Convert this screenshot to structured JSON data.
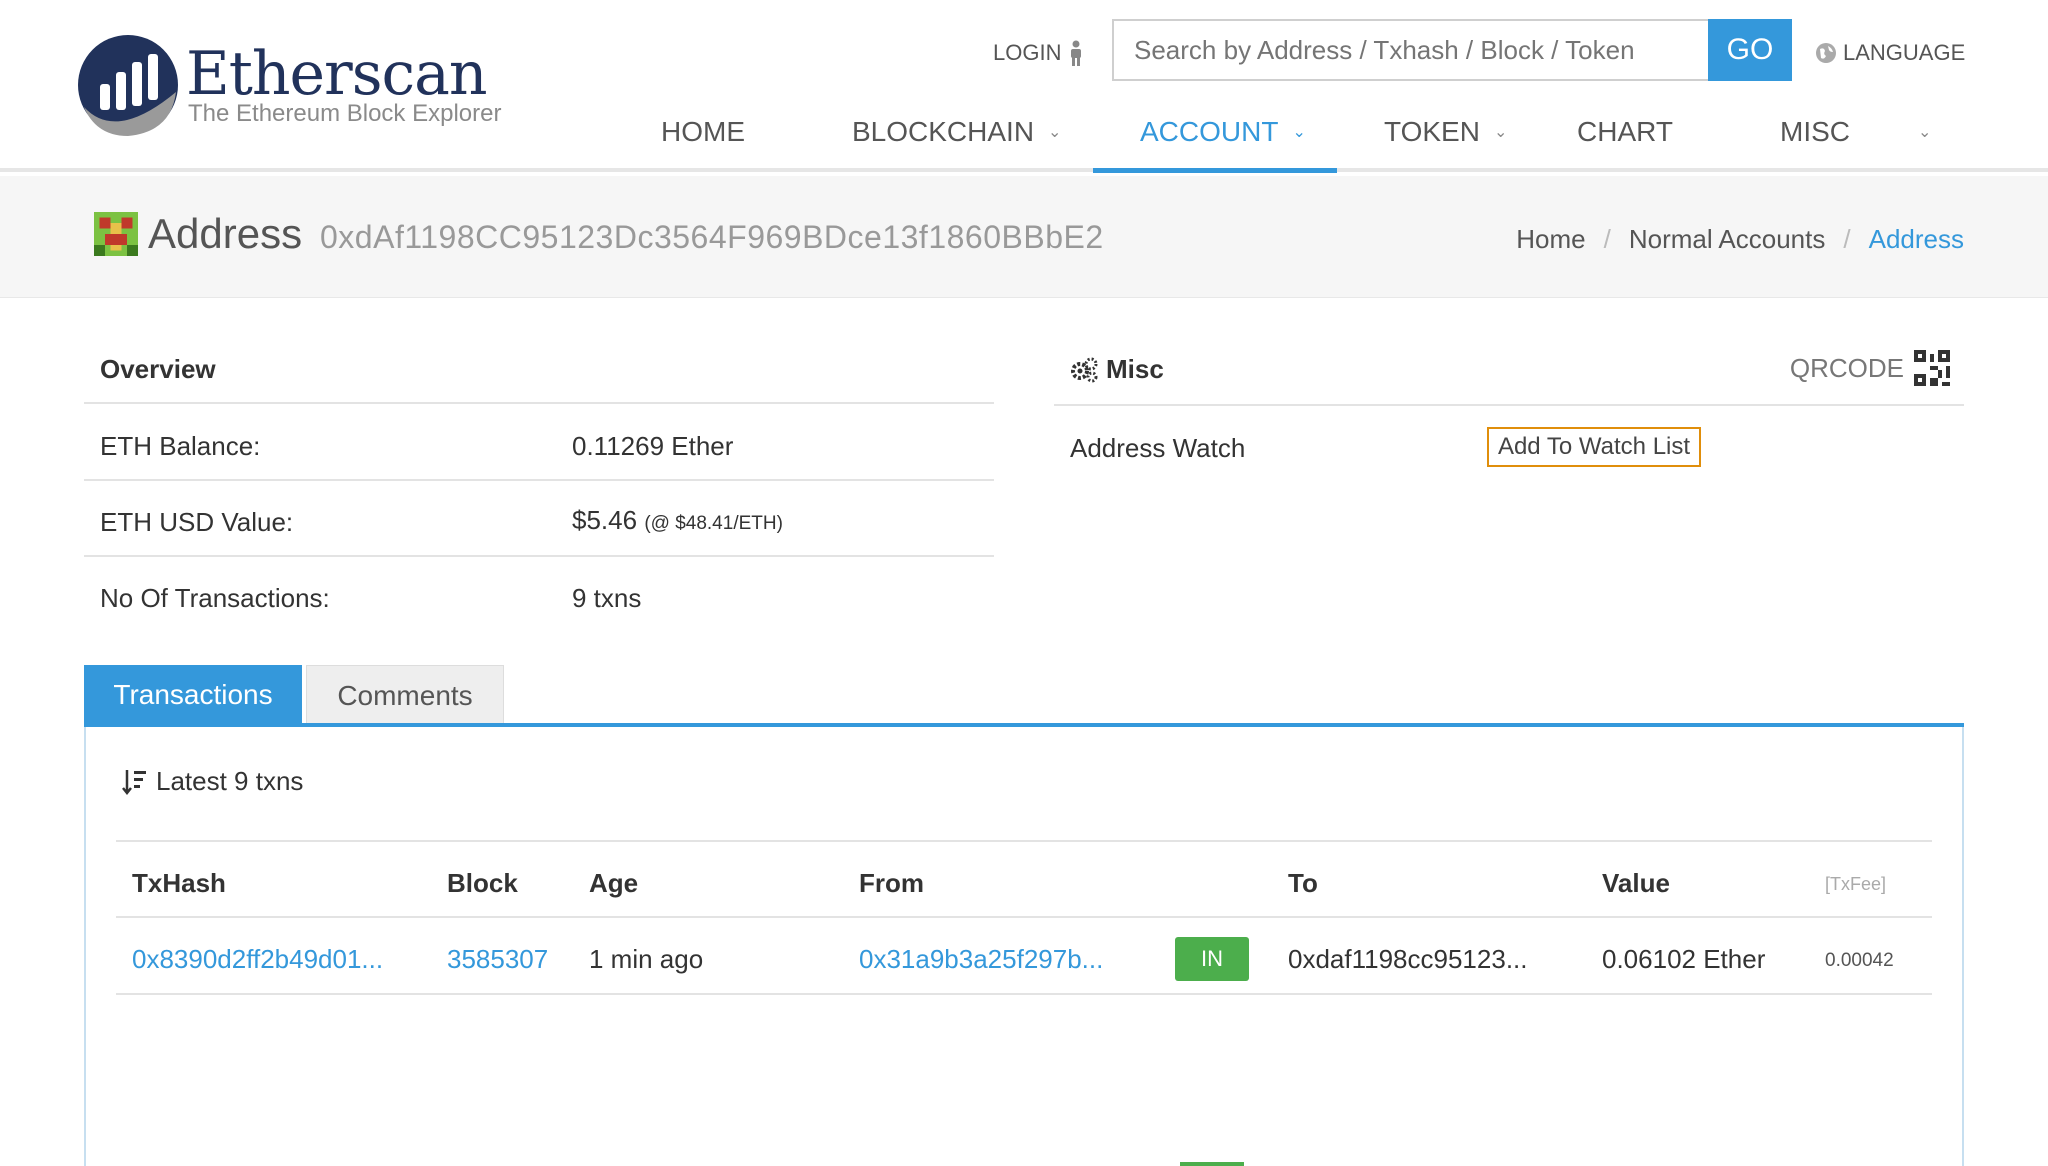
{
  "header": {
    "logo_name": "Etherscan",
    "logo_tagline": "The Ethereum Block Explorer",
    "login_label": "LOGIN",
    "search_placeholder": "Search by Address / Txhash / Block / Token",
    "go_label": "GO",
    "language_label": "LANGUAGE",
    "nav": [
      {
        "label": "HOME",
        "dropdown": false
      },
      {
        "label": "BLOCKCHAIN",
        "dropdown": true
      },
      {
        "label": "ACCOUNT",
        "dropdown": true,
        "active": true
      },
      {
        "label": "TOKEN",
        "dropdown": true
      },
      {
        "label": "CHART",
        "dropdown": false
      },
      {
        "label": "MISC",
        "dropdown": true
      }
    ],
    "accent_color": "#3498db"
  },
  "subheader": {
    "title": "Address",
    "address": "0xdAf1198CC95123Dc3564F969BDce13f1860BBbE2",
    "breadcrumb": [
      "Home",
      "Normal Accounts",
      "Address"
    ]
  },
  "overview": {
    "title": "Overview",
    "rows": [
      {
        "label": "ETH Balance:",
        "value": "0.11269 Ether"
      },
      {
        "label": "ETH USD Value:",
        "value": "$5.46",
        "note": "(@ $48.41/ETH)"
      },
      {
        "label": "No Of Transactions:",
        "value": "9 txns"
      }
    ]
  },
  "misc": {
    "title": "Misc",
    "qrcode_label": "QRCODE",
    "address_watch_label": "Address Watch",
    "watch_button": "Add To Watch List"
  },
  "tabs": [
    {
      "label": "Transactions",
      "active": true
    },
    {
      "label": "Comments",
      "active": false
    }
  ],
  "transactions": {
    "summary": "Latest 9 txns",
    "columns": [
      "TxHash",
      "Block",
      "Age",
      "From",
      "To",
      "Value",
      "[TxFee]"
    ],
    "rows": [
      {
        "txhash": "0x8390d2ff2b49d01...",
        "block": "3585307",
        "age": "1 min ago",
        "from": "0x31a9b3a25f297b...",
        "direction": "IN",
        "to": "0xdaf1198cc95123...",
        "value": "0.06102 Ether",
        "fee": "0.00042"
      }
    ]
  }
}
